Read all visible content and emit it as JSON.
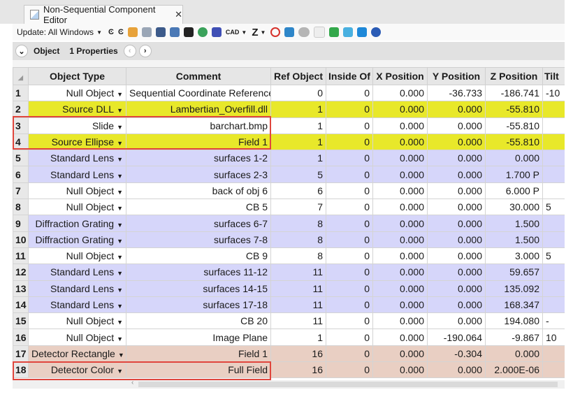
{
  "tab": {
    "title": "Non-Sequential Component Editor",
    "close": "✕"
  },
  "toolbar": {
    "update_label": "Update: All Windows",
    "icons": [
      "rotate-c-icon",
      "refresh-c-icon",
      "ray-trace-icon",
      "view-icon",
      "solid-icon",
      "shaded-icon",
      "grid-icon",
      "dots-icon",
      "hexagon-icon",
      "cad-icon",
      "z-icon",
      "no-icon",
      "curve-icon",
      "toggle-icon",
      "page-icon",
      "swap-icon",
      "arrows-icon",
      "arrow-right-icon",
      "help-icon"
    ],
    "cad_label": "CAD",
    "z_label": "Z"
  },
  "propbar": {
    "object_label": "Object",
    "properties_label": "1 Properties"
  },
  "columns": [
    "",
    "Object Type",
    "Comment",
    "Ref Object",
    "Inside Of",
    "X Position",
    "Y Position",
    "Z Position",
    "Tilt"
  ],
  "rows": [
    {
      "n": "1",
      "type": "Null Object",
      "comment": "Sequential Coordinate Reference",
      "ref": "0",
      "inside": "0",
      "x": "0.000",
      "y": "-36.733",
      "z": "-186.741",
      "tilt": "-10",
      "color": "white"
    },
    {
      "n": "2",
      "type": "Source DLL",
      "comment": "Lambertian_Overfill.dll",
      "ref": "1",
      "inside": "0",
      "x": "0.000",
      "y": "0.000",
      "z": "-55.810",
      "tilt": "",
      "color": "yellow"
    },
    {
      "n": "3",
      "type": "Slide",
      "comment": "barchart.bmp",
      "ref": "1",
      "inside": "0",
      "x": "0.000",
      "y": "0.000",
      "z": "-55.810",
      "tilt": "",
      "color": "white"
    },
    {
      "n": "4",
      "type": "Source Ellipse",
      "comment": "Field 1",
      "ref": "1",
      "inside": "0",
      "x": "0.000",
      "y": "0.000",
      "z": "-55.810",
      "tilt": "",
      "color": "yellow"
    },
    {
      "n": "5",
      "type": "Standard Lens",
      "comment": "surfaces 1-2",
      "ref": "1",
      "inside": "0",
      "x": "0.000",
      "y": "0.000",
      "z": "0.000",
      "tilt": "",
      "color": "lavender"
    },
    {
      "n": "6",
      "type": "Standard Lens",
      "comment": "surfaces 2-3",
      "ref": "5",
      "inside": "0",
      "x": "0.000",
      "y": "0.000",
      "z": "1.700 P",
      "tilt": "",
      "color": "lavender"
    },
    {
      "n": "7",
      "type": "Null Object",
      "comment": "back of obj 6",
      "ref": "6",
      "inside": "0",
      "x": "0.000",
      "y": "0.000",
      "z": "6.000 P",
      "tilt": "",
      "color": "white"
    },
    {
      "n": "8",
      "type": "Null Object",
      "comment": "CB 5",
      "ref": "7",
      "inside": "0",
      "x": "0.000",
      "y": "0.000",
      "z": "30.000",
      "tilt": "5",
      "color": "white"
    },
    {
      "n": "9",
      "type": "Diffraction Grating",
      "comment": "surfaces 6-7",
      "ref": "8",
      "inside": "0",
      "x": "0.000",
      "y": "0.000",
      "z": "1.500",
      "tilt": "",
      "color": "lavender"
    },
    {
      "n": "10",
      "type": "Diffraction Grating",
      "comment": "surfaces 7-8",
      "ref": "8",
      "inside": "0",
      "x": "0.000",
      "y": "0.000",
      "z": "1.500",
      "tilt": "",
      "color": "lavender"
    },
    {
      "n": "11",
      "type": "Null Object",
      "comment": "CB 9",
      "ref": "8",
      "inside": "0",
      "x": "0.000",
      "y": "0.000",
      "z": "3.000",
      "tilt": "5",
      "color": "white"
    },
    {
      "n": "12",
      "type": "Standard Lens",
      "comment": "surfaces 11-12",
      "ref": "11",
      "inside": "0",
      "x": "0.000",
      "y": "0.000",
      "z": "59.657",
      "tilt": "",
      "color": "lavender"
    },
    {
      "n": "13",
      "type": "Standard Lens",
      "comment": "surfaces 14-15",
      "ref": "11",
      "inside": "0",
      "x": "0.000",
      "y": "0.000",
      "z": "135.092",
      "tilt": "",
      "color": "lavender"
    },
    {
      "n": "14",
      "type": "Standard Lens",
      "comment": "surfaces 17-18",
      "ref": "11",
      "inside": "0",
      "x": "0.000",
      "y": "0.000",
      "z": "168.347",
      "tilt": "",
      "color": "lavender"
    },
    {
      "n": "15",
      "type": "Null Object",
      "comment": "CB 20",
      "ref": "11",
      "inside": "0",
      "x": "0.000",
      "y": "0.000",
      "z": "194.080",
      "tilt": "-",
      "color": "white"
    },
    {
      "n": "16",
      "type": "Null Object",
      "comment": "Image Plane",
      "ref": "1",
      "inside": "0",
      "x": "0.000",
      "y": "-190.064",
      "z": "-9.867",
      "tilt": "10",
      "color": "white"
    },
    {
      "n": "17",
      "type": "Detector Rectangle",
      "comment": "Field 1",
      "ref": "16",
      "inside": "0",
      "x": "0.000",
      "y": "-0.304",
      "z": "0.000",
      "tilt": "",
      "color": "rose"
    },
    {
      "n": "18",
      "type": "Detector Color",
      "comment": "Full Field",
      "ref": "16",
      "inside": "0",
      "x": "0.000",
      "y": "0.000",
      "z": "2.000E-06",
      "tilt": "",
      "color": "rose"
    }
  ],
  "colors": {
    "white": "#ffffff",
    "yellow": "#e8e82a",
    "lavender": "#d6d6fa",
    "rose": "#e9cfc3",
    "highlight": "#e0463d"
  },
  "highlighted_rows": [
    "3-4",
    "18"
  ]
}
